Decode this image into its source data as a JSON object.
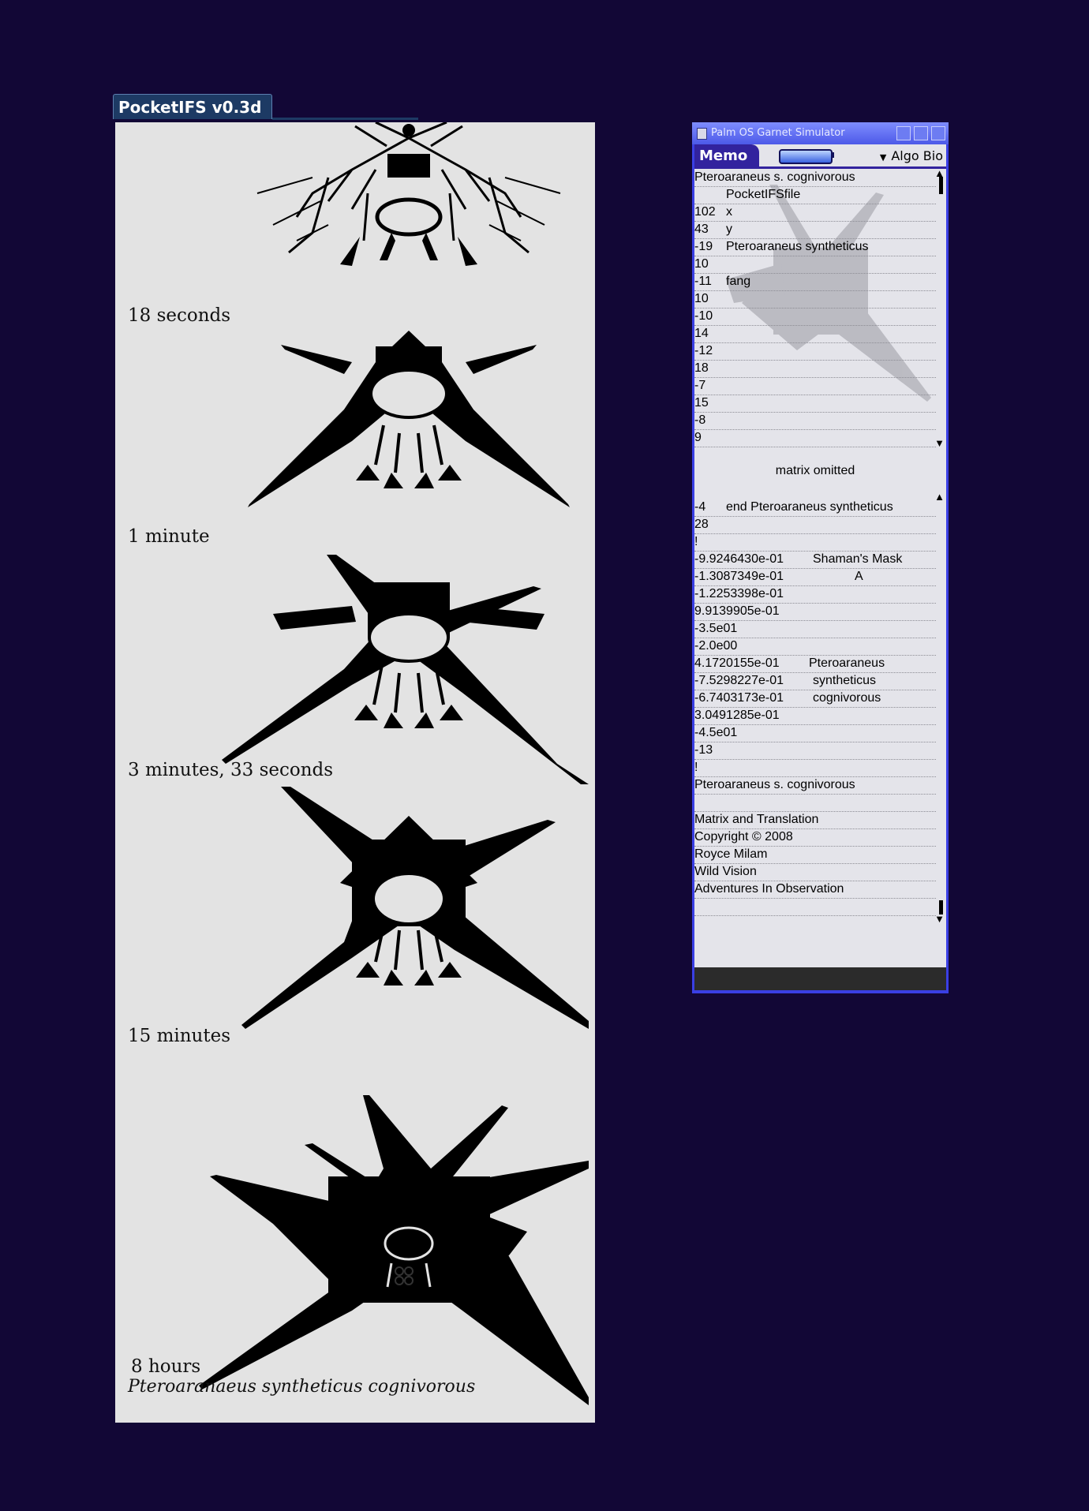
{
  "pocketifs": {
    "title": "PocketIFS v0.3d",
    "panels": [
      {
        "caption": "18 seconds"
      },
      {
        "caption": "1 minute"
      },
      {
        "caption": "3 minutes, 33 seconds"
      },
      {
        "caption": "15 minutes"
      },
      {
        "caption": "8 hours"
      }
    ],
    "species_caption": "Pteroaranaeus syntheticus cognivorous"
  },
  "simulator": {
    "window_title": "Palm OS Garnet Simulator",
    "app_title": "Memo",
    "category": "Algo Bio",
    "memo_top": [
      {
        "a": "Pteroaraneus s. cognivorous",
        "b": ""
      },
      {
        "a": "",
        "b": "PocketIFSfile"
      },
      {
        "a": "102",
        "b": "x"
      },
      {
        "a": "43",
        "b": "y"
      },
      {
        "a": "-19",
        "b": "Pteroaraneus syntheticus"
      },
      {
        "a": "10",
        "b": ""
      },
      {
        "a": "-11",
        "b": "fang"
      },
      {
        "a": "10",
        "b": ""
      },
      {
        "a": "-10",
        "b": ""
      },
      {
        "a": "14",
        "b": ""
      },
      {
        "a": "-12",
        "b": ""
      },
      {
        "a": "18",
        "b": ""
      },
      {
        "a": "-7",
        "b": ""
      },
      {
        "a": "15",
        "b": ""
      },
      {
        "a": "-8",
        "b": ""
      },
      {
        "a": "9",
        "b": ""
      }
    ],
    "matrix_omitted": "matrix omitted",
    "memo_bottom": [
      {
        "a": "-4",
        "b": "end Pteroaraneus syntheticus",
        "bx": 40
      },
      {
        "a": "28",
        "b": "",
        "bx": 0
      },
      {
        "a": "!",
        "b": "",
        "bx": 0
      },
      {
        "a": "-9.9246430e-01",
        "b": "Shaman's Mask",
        "bx": 150
      },
      {
        "a": "-1.3087349e-01",
        "b": "A",
        "bx": 203
      },
      {
        "a": "-1.2253398e-01",
        "b": "",
        "bx": 0
      },
      {
        "a": "9.9139905e-01",
        "b": "",
        "bx": 0
      },
      {
        "a": "-3.5e01",
        "b": "",
        "bx": 0
      },
      {
        "a": "-2.0e00",
        "b": "",
        "bx": 0
      },
      {
        "a": "4.1720155e-01",
        "b": "Pteroaraneus",
        "bx": 145
      },
      {
        "a": "-7.5298227e-01",
        "b": "syntheticus",
        "bx": 150
      },
      {
        "a": "-6.7403173e-01",
        "b": "cognivorous",
        "bx": 150
      },
      {
        "a": "3.0491285e-01",
        "b": "",
        "bx": 0
      },
      {
        "a": "-4.5e01",
        "b": "",
        "bx": 0
      },
      {
        "a": "-13",
        "b": "",
        "bx": 0
      },
      {
        "a": "!",
        "b": "",
        "bx": 0
      },
      {
        "a": "Pteroaraneus s. cognivorous",
        "b": "",
        "bx": 0
      },
      {
        "a": "",
        "b": "",
        "bx": 0
      },
      {
        "a": "Matrix and Translation",
        "b": "",
        "bx": 0
      },
      {
        "a": "Copyright © 2008",
        "b": "",
        "bx": 0
      },
      {
        "a": "Royce Milam",
        "b": "",
        "bx": 0
      },
      {
        "a": "Wild Vision",
        "b": "",
        "bx": 0
      },
      {
        "a": "Adventures In Observation",
        "b": "",
        "bx": 0
      },
      {
        "a": "",
        "b": "",
        "bx": 0
      }
    ]
  },
  "colors": {
    "background": "#120736",
    "memo_accent": "#32239e",
    "simulator_frame": "#3a3fe4"
  }
}
